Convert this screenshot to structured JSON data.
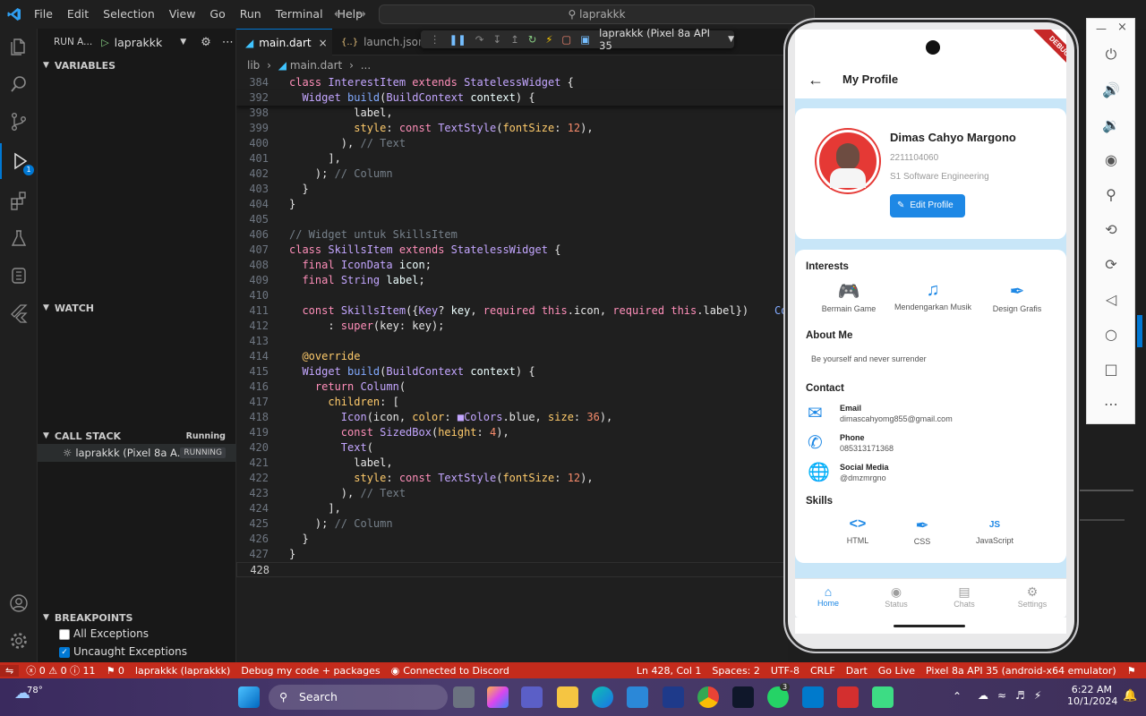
{
  "window": {
    "menu": [
      "File",
      "Edit",
      "Selection",
      "View",
      "Go",
      "Run",
      "Terminal",
      "Help"
    ],
    "search": "laprakkk"
  },
  "activity": {
    "debug_badge": "1"
  },
  "sidebar": {
    "run_label": "RUN A...",
    "run_config": "laprakkk",
    "variables": "VARIABLES",
    "watch": "WATCH",
    "callstack": "CALL STACK",
    "callstack_status": "Running",
    "callstack_item": "laprakkk (Pixel 8a A...",
    "callstack_item_status": "RUNNING",
    "breakpoints": "BREAKPOINTS",
    "bp_all": "All Exceptions",
    "bp_uncaught": "Uncaught Exceptions"
  },
  "tabs": [
    {
      "label": "main.dart",
      "icon": "dart-icon"
    },
    {
      "label": "launch.json",
      "icon": "json-icon"
    }
  ],
  "debug_toolbar": {
    "device": "laprakkk (Pixel 8a API 35"
  },
  "breadcrumb": {
    "folder": "lib",
    "file": "main.dart",
    "rest": "..."
  },
  "code": {
    "sticky": [
      {
        "ln": "384",
        "tokens": [
          [
            "kw",
            "class "
          ],
          [
            "ty",
            "InterestItem "
          ],
          [
            "kw",
            "extends "
          ],
          [
            "ty",
            "StatelessWidget "
          ],
          [
            "pl",
            "{"
          ]
        ]
      },
      {
        "ln": "392",
        "tokens": [
          [
            "pl",
            "  "
          ],
          [
            "ty",
            "Widget "
          ],
          [
            "fn",
            "build"
          ],
          [
            "pl",
            "("
          ],
          [
            "ty",
            "BuildContext "
          ],
          [
            "va",
            "context"
          ],
          [
            "pl",
            ") {"
          ]
        ]
      }
    ],
    "lines": [
      {
        "ln": "398",
        "tokens": [
          [
            "pl",
            "          label,"
          ]
        ]
      },
      {
        "ln": "399",
        "tokens": [
          [
            "pl",
            "          "
          ],
          [
            "pr",
            "style"
          ],
          [
            "pl",
            ": "
          ],
          [
            "kw",
            "const "
          ],
          [
            "ty",
            "TextStyle"
          ],
          [
            "pl",
            "("
          ],
          [
            "pr",
            "fontSize"
          ],
          [
            "pl",
            ": "
          ],
          [
            "num",
            "12"
          ],
          [
            "pl",
            "),"
          ]
        ]
      },
      {
        "ln": "400",
        "tokens": [
          [
            "pl",
            "        ), "
          ],
          [
            "cm",
            "// Text"
          ]
        ]
      },
      {
        "ln": "401",
        "tokens": [
          [
            "pl",
            "      ],"
          ]
        ]
      },
      {
        "ln": "402",
        "tokens": [
          [
            "pl",
            "    ); "
          ],
          [
            "cm",
            "// Column"
          ]
        ]
      },
      {
        "ln": "403",
        "tokens": [
          [
            "pl",
            "  }"
          ]
        ]
      },
      {
        "ln": "404",
        "tokens": [
          [
            "pl",
            "}"
          ]
        ]
      },
      {
        "ln": "405",
        "tokens": [
          [
            "pl",
            ""
          ]
        ]
      },
      {
        "ln": "406",
        "tokens": [
          [
            "cm",
            "// Widget untuk SkillsItem"
          ]
        ]
      },
      {
        "ln": "407",
        "tokens": [
          [
            "kw",
            "class "
          ],
          [
            "ty",
            "SkillsItem "
          ],
          [
            "kw",
            "extends "
          ],
          [
            "ty",
            "StatelessWidget "
          ],
          [
            "pl",
            "{"
          ]
        ]
      },
      {
        "ln": "408",
        "tokens": [
          [
            "pl",
            "  "
          ],
          [
            "kw",
            "final "
          ],
          [
            "ty",
            "IconData "
          ],
          [
            "va",
            "icon"
          ],
          [
            "pl",
            ";"
          ]
        ]
      },
      {
        "ln": "409",
        "tokens": [
          [
            "pl",
            "  "
          ],
          [
            "kw",
            "final "
          ],
          [
            "ty",
            "String "
          ],
          [
            "va",
            "label"
          ],
          [
            "pl",
            ";"
          ]
        ]
      },
      {
        "ln": "410",
        "tokens": [
          [
            "pl",
            ""
          ]
        ]
      },
      {
        "ln": "411",
        "tokens": [
          [
            "pl",
            "  "
          ],
          [
            "kw",
            "const "
          ],
          [
            "ty",
            "SkillsItem"
          ],
          [
            "pl",
            "({"
          ],
          [
            "ty",
            "Key"
          ],
          [
            "pl",
            "? "
          ],
          [
            "va",
            "key"
          ],
          [
            "pl",
            ", "
          ],
          [
            "kw",
            "required "
          ],
          [
            "kw",
            "this"
          ],
          [
            "pl",
            ".icon, "
          ],
          [
            "kw",
            "required "
          ],
          [
            "kw",
            "this"
          ],
          [
            "pl",
            ".label})    "
          ],
          [
            "fn",
            "Conver"
          ]
        ]
      },
      {
        "ln": "412",
        "tokens": [
          [
            "pl",
            "      : "
          ],
          [
            "kw",
            "super"
          ],
          [
            "pl",
            "(key: key);"
          ]
        ]
      },
      {
        "ln": "413",
        "tokens": [
          [
            "pl",
            ""
          ]
        ]
      },
      {
        "ln": "414",
        "tokens": [
          [
            "pl",
            "  "
          ],
          [
            "pr",
            "@override"
          ]
        ]
      },
      {
        "ln": "415",
        "tokens": [
          [
            "pl",
            "  "
          ],
          [
            "ty",
            "Widget "
          ],
          [
            "fn",
            "build"
          ],
          [
            "pl",
            "("
          ],
          [
            "ty",
            "BuildContext "
          ],
          [
            "va",
            "context"
          ],
          [
            "pl",
            ") {"
          ]
        ]
      },
      {
        "ln": "416",
        "tokens": [
          [
            "pl",
            "    "
          ],
          [
            "kw",
            "return "
          ],
          [
            "ty",
            "Column"
          ],
          [
            "pl",
            "("
          ]
        ]
      },
      {
        "ln": "417",
        "tokens": [
          [
            "pl",
            "      "
          ],
          [
            "pr",
            "children"
          ],
          [
            "pl",
            ": ["
          ]
        ]
      },
      {
        "ln": "418",
        "tokens": [
          [
            "pl",
            "        "
          ],
          [
            "ty",
            "Icon"
          ],
          [
            "pl",
            "(icon, "
          ],
          [
            "pr",
            "color"
          ],
          [
            "pl",
            ": "
          ],
          [
            "ty",
            "■Colors"
          ],
          [
            "pl",
            ".blue, "
          ],
          [
            "pr",
            "size"
          ],
          [
            "pl",
            ": "
          ],
          [
            "num",
            "36"
          ],
          [
            "pl",
            "),"
          ]
        ]
      },
      {
        "ln": "419",
        "tokens": [
          [
            "pl",
            "        "
          ],
          [
            "kw",
            "const "
          ],
          [
            "ty",
            "SizedBox"
          ],
          [
            "pl",
            "("
          ],
          [
            "pr",
            "height"
          ],
          [
            "pl",
            ": "
          ],
          [
            "num",
            "4"
          ],
          [
            "pl",
            "),"
          ]
        ]
      },
      {
        "ln": "420",
        "tokens": [
          [
            "pl",
            "        "
          ],
          [
            "ty",
            "Text"
          ],
          [
            "pl",
            "("
          ]
        ]
      },
      {
        "ln": "421",
        "tokens": [
          [
            "pl",
            "          label,"
          ]
        ]
      },
      {
        "ln": "422",
        "tokens": [
          [
            "pl",
            "          "
          ],
          [
            "pr",
            "style"
          ],
          [
            "pl",
            ": "
          ],
          [
            "kw",
            "const "
          ],
          [
            "ty",
            "TextStyle"
          ],
          [
            "pl",
            "("
          ],
          [
            "pr",
            "fontSize"
          ],
          [
            "pl",
            ": "
          ],
          [
            "num",
            "12"
          ],
          [
            "pl",
            "),"
          ]
        ]
      },
      {
        "ln": "423",
        "tokens": [
          [
            "pl",
            "        ), "
          ],
          [
            "cm",
            "// Text"
          ]
        ]
      },
      {
        "ln": "424",
        "tokens": [
          [
            "pl",
            "      ],"
          ]
        ]
      },
      {
        "ln": "425",
        "tokens": [
          [
            "pl",
            "    ); "
          ],
          [
            "cm",
            "// Column"
          ]
        ]
      },
      {
        "ln": "426",
        "tokens": [
          [
            "pl",
            "  }"
          ]
        ]
      },
      {
        "ln": "427",
        "tokens": [
          [
            "pl",
            "}"
          ]
        ]
      },
      {
        "ln": "428",
        "tokens": [
          [
            "pl",
            ""
          ]
        ]
      }
    ]
  },
  "statusbar": {
    "errors": "ⓧ 0 ⚠ 0 ⓘ 11",
    "ports": "⚑ 0",
    "target": "laprakkk (laprakkk)",
    "debug": "Debug my code + packages",
    "discord": "Connected to Discord",
    "position": "Ln 428, Col 1",
    "spaces": "Spaces: 2",
    "encoding": "UTF-8",
    "eol": "CRLF",
    "lang": "Dart",
    "live": "Go Live",
    "device": "Pixel 8a API 35 (android-x64 emulator)"
  },
  "taskbar": {
    "weather": "78°",
    "search": "Search",
    "time": "6:22 AM",
    "date": "10/1/2024",
    "whatsapp_badge": "3"
  },
  "app": {
    "banner": "DEBUG",
    "title": "My Profile",
    "name": "Dimas Cahyo Margono",
    "nim": "2211104060",
    "major": "S1 Software Engineering",
    "edit": "Edit Profile",
    "interests_title": "Interests",
    "interests": [
      "Bermain Game",
      "Mendengarkan Musik",
      "Design Grafis"
    ],
    "about_title": "About Me",
    "about": "Be yourself and never surrender",
    "contact_title": "Contact",
    "contacts": [
      {
        "label": "Email",
        "value": "dimascahyomg855@gmail.com",
        "icon": "email-icon"
      },
      {
        "label": "Phone",
        "value": "085313171368",
        "icon": "phone-icon"
      },
      {
        "label": "Social Media",
        "value": "@dmzmrgno",
        "icon": "globe-icon"
      }
    ],
    "skills_title": "Skills",
    "skills": [
      {
        "label": "HTML",
        "icon": "code-icon"
      },
      {
        "label": "CSS",
        "icon": "brush-icon"
      },
      {
        "label": "JavaScript",
        "icon": "js-icon"
      }
    ],
    "nav": [
      "Home",
      "Status",
      "Chats",
      "Settings"
    ],
    "accent": "#1e88e5"
  }
}
